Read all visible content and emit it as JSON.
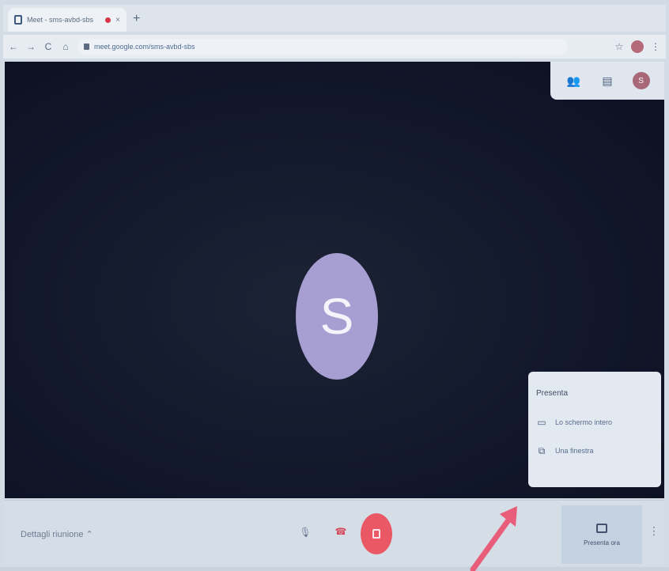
{
  "browser": {
    "tab_title": "Meet - sms-avbd-sbs",
    "tab_close": "×",
    "new_tab": "+",
    "url": "meet.google.com/sms-avbd-sbs",
    "nav": {
      "back": "←",
      "forward": "→",
      "reload": "C",
      "home": "⌂"
    }
  },
  "meet": {
    "participant_initial": "S",
    "self_initial": "S",
    "present_menu": {
      "title": "Presenta",
      "items": [
        {
          "label": "Lo schermo intero",
          "icon": "monitor-icon"
        },
        {
          "label": "Una finestra",
          "icon": "window-icon"
        }
      ]
    },
    "bottom_bar": {
      "meeting_details": "Dettagli riunione ⌃",
      "present_label": "Presenta ora",
      "more": "⋮"
    }
  },
  "colors": {
    "stage": "#11162a",
    "avatar": "#a79ed2",
    "camera_off": "#ea5866",
    "annotation": "#e85d7a"
  }
}
